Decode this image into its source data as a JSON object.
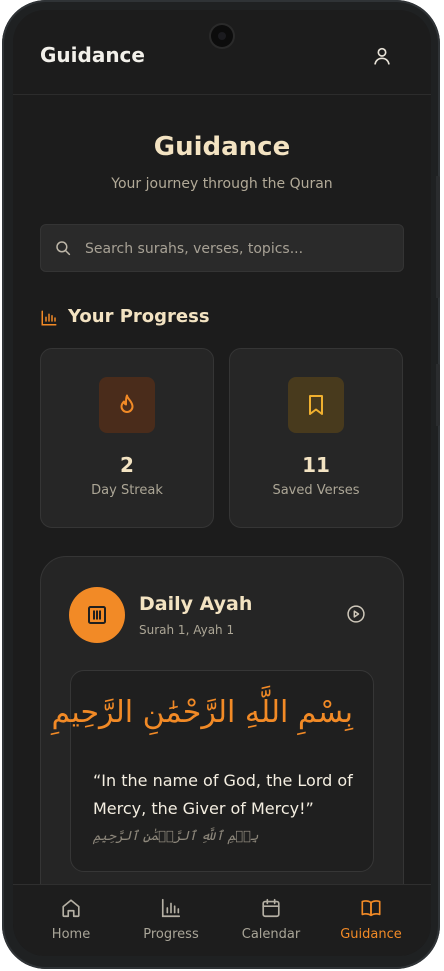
{
  "appbar": {
    "title": "Guidance"
  },
  "hero": {
    "title": "Guidance",
    "subtitle": "Your journey through the Quran"
  },
  "search": {
    "placeholder": "Search surahs, verses, topics..."
  },
  "progress": {
    "title": "Your Progress",
    "stats": [
      {
        "value": "2",
        "label": "Day Streak",
        "icon": "flame-icon"
      },
      {
        "value": "11",
        "label": "Saved Verses",
        "icon": "bookmark-icon"
      }
    ]
  },
  "daily_ayah": {
    "title": "Daily Ayah",
    "reference": "Surah 1, Ayah 1",
    "arabic": "بِسْمِ اللَّهِ الرَّحْمَٰنِ الرَّحِيمِ",
    "translation": "“In the name of God, the Lord of Mercy, the Giver of Mercy!”",
    "transliteration": "بِسۡمِ ٱللَّهِ ٱلرَّحۡمَٰنِ ٱلرَّحِيمِ"
  },
  "nav": {
    "items": [
      {
        "label": "Home",
        "icon": "home-icon"
      },
      {
        "label": "Progress",
        "icon": "bar-chart-icon"
      },
      {
        "label": "Calendar",
        "icon": "calendar-icon"
      },
      {
        "label": "Guidance",
        "icon": "book-icon",
        "active": true
      }
    ]
  },
  "colors": {
    "accent": "#f28a26",
    "heading": "#f3e3c2",
    "background": "#1c1c1c",
    "card": "#262626"
  }
}
